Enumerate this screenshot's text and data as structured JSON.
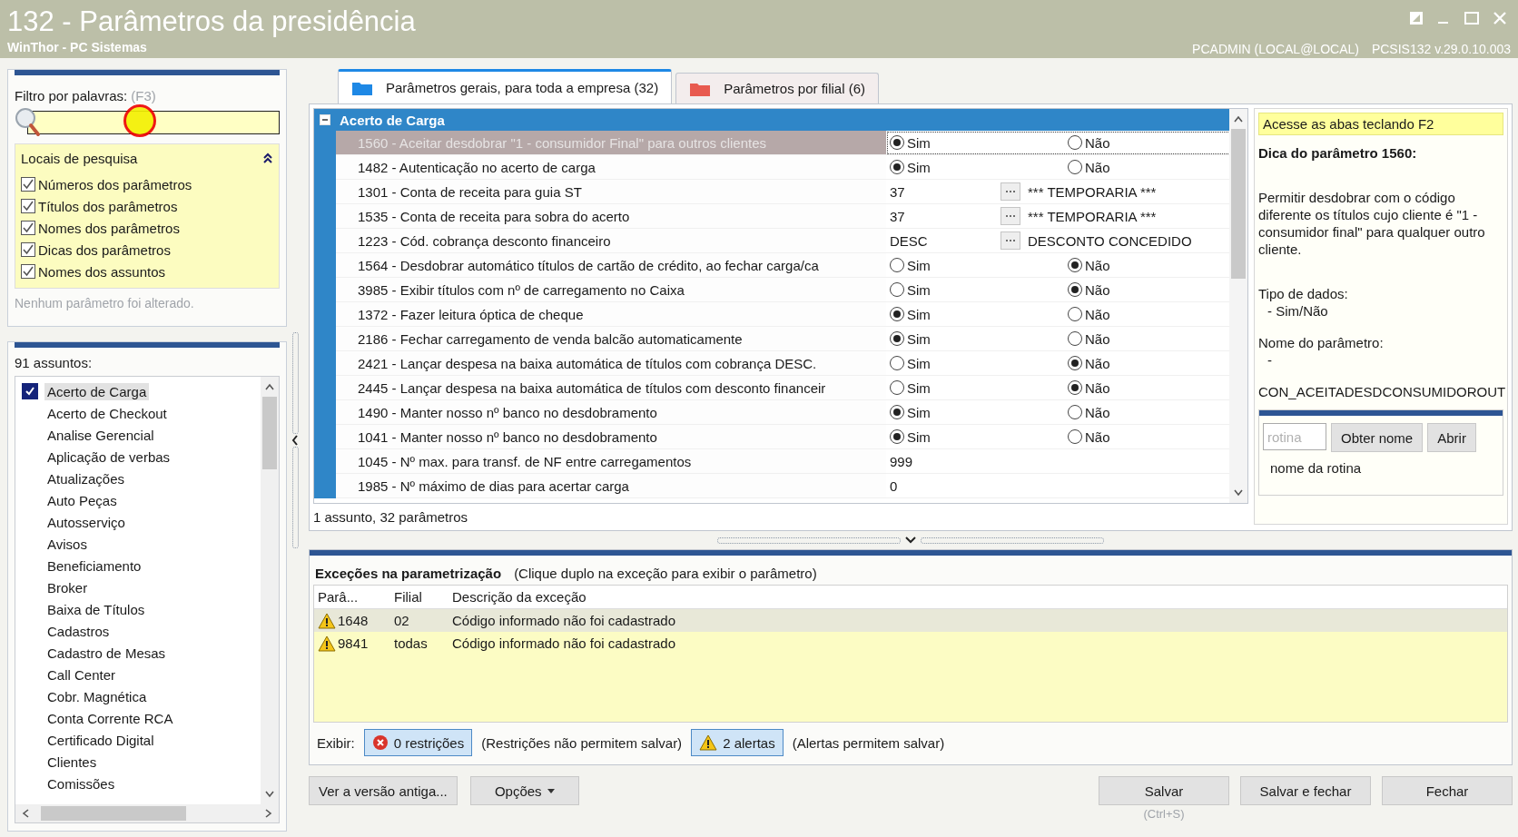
{
  "window": {
    "title": "132 - Parâmetros da presidência",
    "subtitle": "WinThor - PC Sistemas",
    "user": "PCADMIN (LOCAL@LOCAL)",
    "version": "PCSIS132  v.29.0.10.003"
  },
  "filter": {
    "label": "Filtro por palavras:",
    "shortcut": "(F3)",
    "search_locations": {
      "title": "Locais de pesquisa",
      "expanded": true,
      "options": [
        {
          "label": "Números dos parâmetros",
          "checked": true
        },
        {
          "label": "Títulos dos parâmetros",
          "checked": true
        },
        {
          "label": "Nomes dos parâmetros",
          "checked": true
        },
        {
          "label": "Dicas dos parâmetros",
          "checked": true
        },
        {
          "label": "Nomes dos assuntos",
          "checked": true
        }
      ]
    },
    "status": "Nenhum parâmetro foi alterado."
  },
  "subjects": {
    "count_label": "91 assuntos:",
    "items": [
      {
        "label": "Acerto de Carga",
        "checked": true,
        "selected": true
      },
      {
        "label": "Acerto de Checkout",
        "checked": false,
        "selected": false
      },
      {
        "label": "Analise Gerencial",
        "checked": false,
        "selected": false
      },
      {
        "label": "Aplicação de verbas",
        "checked": false,
        "selected": false
      },
      {
        "label": "Atualizações",
        "checked": false,
        "selected": false
      },
      {
        "label": "Auto Peças",
        "checked": false,
        "selected": false
      },
      {
        "label": "Autosserviço",
        "checked": false,
        "selected": false
      },
      {
        "label": "Avisos",
        "checked": false,
        "selected": false
      },
      {
        "label": "Beneficiamento",
        "checked": false,
        "selected": false
      },
      {
        "label": "Broker",
        "checked": false,
        "selected": false
      },
      {
        "label": "Baixa de Títulos",
        "checked": false,
        "selected": false
      },
      {
        "label": "Cadastros",
        "checked": false,
        "selected": false
      },
      {
        "label": "Cadastro de Mesas",
        "checked": false,
        "selected": false
      },
      {
        "label": "Call Center",
        "checked": false,
        "selected": false
      },
      {
        "label": "Cobr. Magnética",
        "checked": false,
        "selected": false
      },
      {
        "label": "Conta Corrente RCA",
        "checked": false,
        "selected": false
      },
      {
        "label": "Certificado Digital",
        "checked": false,
        "selected": false
      },
      {
        "label": "Clientes",
        "checked": false,
        "selected": false
      },
      {
        "label": "Comissões",
        "checked": false,
        "selected": false
      }
    ]
  },
  "tabs": [
    {
      "label": "Parâmetros gerais, para toda a empresa  (32)",
      "selected": true,
      "color": "#1e88e5"
    },
    {
      "label": "Parâmetros por filial  (6)",
      "selected": false,
      "color": "#e85a4f"
    }
  ],
  "grid": {
    "group": "Acerto de Carga",
    "expanded": true,
    "rows": [
      {
        "label": "1560 - Aceitar desdobrar \"1 - consumidor Final\" para outros clientes",
        "selected": true,
        "kind": "radio",
        "options": [
          {
            "label": "Sim",
            "selected": true
          },
          {
            "label": "Não",
            "selected": false
          }
        ]
      },
      {
        "label": "1482 - Autenticação no acerto de carga",
        "selected": false,
        "kind": "radio",
        "options": [
          {
            "label": "Sim",
            "selected": true
          },
          {
            "label": "Não",
            "selected": false
          }
        ]
      },
      {
        "label": "1301 - Conta de receita para guia ST",
        "selected": false,
        "kind": "lookup",
        "code": "37",
        "description": "*** TEMPORARIA ***"
      },
      {
        "label": "1535 - Conta de receita para sobra do acerto",
        "selected": false,
        "kind": "lookup",
        "code": "37",
        "description": "*** TEMPORARIA ***"
      },
      {
        "label": "1223 - Cód. cobrança desconto financeiro",
        "selected": false,
        "kind": "lookup",
        "code": "DESC",
        "description": "DESCONTO CONCEDIDO"
      },
      {
        "label": "1564 - Desdobrar automático títulos de cartão de crédito, ao fechar carga/ca",
        "selected": false,
        "kind": "radio",
        "options": [
          {
            "label": "Sim",
            "selected": false
          },
          {
            "label": "Não",
            "selected": true
          }
        ]
      },
      {
        "label": "3985 - Exibir títulos com nº de carregamento no Caixa",
        "selected": false,
        "kind": "radio",
        "options": [
          {
            "label": "Sim",
            "selected": false
          },
          {
            "label": "Não",
            "selected": true
          }
        ]
      },
      {
        "label": "1372 - Fazer leitura óptica de cheque",
        "selected": false,
        "kind": "radio",
        "options": [
          {
            "label": "Sim",
            "selected": true
          },
          {
            "label": "Não",
            "selected": false
          }
        ]
      },
      {
        "label": "2186 - Fechar carregamento de venda balcão automaticamente",
        "selected": false,
        "kind": "radio",
        "options": [
          {
            "label": "Sim",
            "selected": true
          },
          {
            "label": "Não",
            "selected": false
          }
        ]
      },
      {
        "label": "2421 - Lançar despesa na baixa automática de títulos com cobrança DESC.",
        "selected": false,
        "kind": "radio",
        "options": [
          {
            "label": "Sim",
            "selected": false
          },
          {
            "label": "Não",
            "selected": true
          }
        ]
      },
      {
        "label": "2445 - Lançar despesa na baixa automática de títulos com desconto financeir",
        "selected": false,
        "kind": "radio",
        "options": [
          {
            "label": "Sim",
            "selected": false
          },
          {
            "label": "Não",
            "selected": true
          }
        ]
      },
      {
        "label": "1490 - Manter nosso nº banco no desdobramento",
        "selected": false,
        "kind": "radio",
        "options": [
          {
            "label": "Sim",
            "selected": true
          },
          {
            "label": "Não",
            "selected": false
          }
        ]
      },
      {
        "label": "1041 - Manter nosso nº banco no desdobramento",
        "selected": false,
        "kind": "radio",
        "options": [
          {
            "label": "Sim",
            "selected": true
          },
          {
            "label": "Não",
            "selected": false
          }
        ]
      },
      {
        "label": "1045 - Nº max. para transf. de NF entre carregamentos",
        "selected": false,
        "kind": "text",
        "value": "999"
      },
      {
        "label": "1985 - Nº máximo de dias para acertar carga",
        "selected": false,
        "kind": "text",
        "value": "0"
      }
    ],
    "summary": "1 assunto, 32 parâmetros"
  },
  "hint": {
    "shortcut_tip": "Acesse as abas teclando F2",
    "title": "Dica do parâmetro 1560:",
    "text": "Permitir desdobrar com o código diferente os títulos cujo cliente é \"1 - consumidor final\" para qualquer outro cliente.",
    "type_label": "Tipo de dados:",
    "type_value": "- Sim/Não",
    "name_label": "Nome do parâmetro:",
    "name_dash": "-",
    "name_value": "CON_ACEITADESDCONSUMIDOROUT"
  },
  "routine_lookup": {
    "placeholder": "rotina",
    "buttons": [
      "Obter nome",
      "Abrir"
    ],
    "result": "nome da rotina"
  },
  "exceptions": {
    "title": "Exceções na parametrização",
    "note": "(Clique duplo na exceção para exibir o parâmetro)",
    "columns": [
      "Parâ...",
      "Filial",
      "Descrição da exceção"
    ],
    "rows": [
      {
        "param": "1648",
        "branch": "02",
        "description": "Código informado não foi cadastrado",
        "selected": true
      },
      {
        "param": "9841",
        "branch": "todas",
        "description": "Código informado não foi cadastrado",
        "selected": false
      }
    ],
    "filter_label": "Exibir:",
    "toggles": [
      {
        "kind": "restriction",
        "label": "0 restrições",
        "note": "(Restrições não permitem salvar)",
        "selected": true
      },
      {
        "kind": "alert",
        "label": "2 alertas",
        "note": "(Alertas permitem salvar)",
        "selected": true
      }
    ]
  },
  "left_buttons": [
    {
      "label": "Ver a versão antiga...",
      "kind": "plain"
    },
    {
      "label": "Opções",
      "kind": "menu"
    }
  ],
  "actions": [
    {
      "label": "Salvar",
      "shortcut": "(Ctrl+S)"
    },
    {
      "label": "Salvar e fechar"
    },
    {
      "label": "Fechar"
    }
  ]
}
